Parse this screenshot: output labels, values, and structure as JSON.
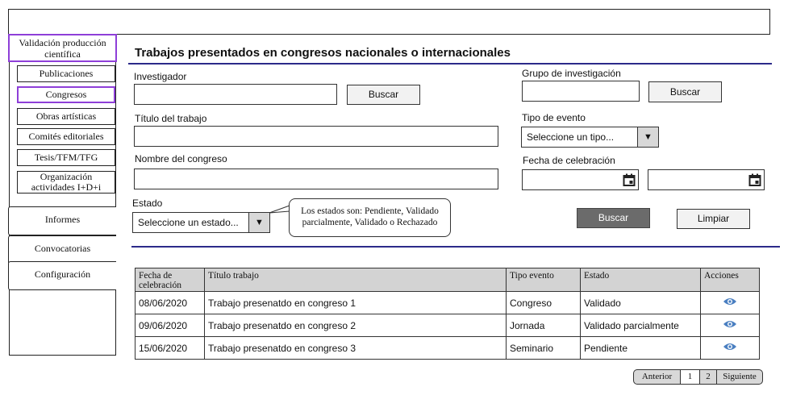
{
  "sidebar": {
    "main_label": "Validación producción científica",
    "sub_items": [
      "Publicaciones",
      "Congresos",
      "Obras artísticas",
      "Comités editoriales",
      "Tesis/TFM/TFG",
      "Organización actividades I+D+i"
    ],
    "sections": [
      "Informes",
      "Convocatorias",
      "Configuración"
    ]
  },
  "page": {
    "title": "Trabajos presentados en congresos nacionales o internacionales"
  },
  "form": {
    "investigador_label": "Investigador",
    "investigador_value": "",
    "buscar_label": "Buscar",
    "grupo_label": "Grupo de investigación",
    "grupo_value": "",
    "titulo_label": "Título del trabajo",
    "titulo_value": "",
    "tipo_evento_label": "Tipo de evento",
    "tipo_evento_value": "Seleccione un tipo...",
    "congreso_label": "Nombre del congreso",
    "congreso_value": "",
    "fecha_label": "Fecha de celebración",
    "estado_label": "Estado",
    "estado_value": "Seleccione un estado...",
    "tooltip": "Los estados son: Pendiente, Validado parcialmente, Validado o Rechazado",
    "search_button": "Buscar",
    "clear_button": "Limpiar",
    "dropdown_glyph": "▼"
  },
  "table": {
    "headers": [
      "Fecha de celebración",
      "Título trabajo",
      "Tipo evento",
      "Estado",
      "Acciones"
    ],
    "rows": [
      [
        "08/06/2020",
        "Trabajo presenatdo en congreso 1",
        "Congreso",
        "Validado"
      ],
      [
        "09/06/2020",
        "Trabajo presenatdo en congreso 2",
        "Jornada",
        "Validado parcialmente"
      ],
      [
        "15/06/2020",
        "Trabajo presenatdo en congreso 3",
        "Seminario",
        "Pendiente"
      ]
    ],
    "action_icon": "eye-icon"
  },
  "pagination": {
    "prev": "Anterior",
    "pages": [
      "1",
      "2"
    ],
    "next": "Siguiente"
  },
  "colors": {
    "accent": "#8e3fd8",
    "rule": "#2c2a8a",
    "eye": "#4a7fc1",
    "dark_button": "#6b6b6b"
  }
}
